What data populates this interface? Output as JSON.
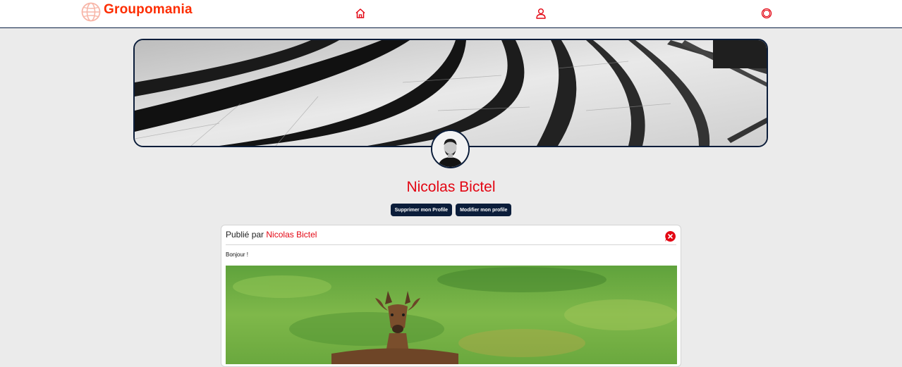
{
  "brand": {
    "name": "Groupomania",
    "color": "#fd2d01"
  },
  "nav": {
    "items": [
      {
        "icon": "home-icon"
      },
      {
        "icon": "user-icon"
      },
      {
        "icon": "logout-icon"
      }
    ]
  },
  "profile": {
    "name": "Nicolas Bictel",
    "name_color": "#e30613",
    "delete_label": "Supprimer mon Profile",
    "edit_label": "Modifier mon profile"
  },
  "post": {
    "published_by": "Publié par",
    "author": "Nicolas Bictel",
    "text": "Bonjour !",
    "delete_icon": "close-circle-icon"
  },
  "colors": {
    "accent": "#e30613",
    "dark": "#0b1d3a",
    "background": "#ebebeb"
  }
}
